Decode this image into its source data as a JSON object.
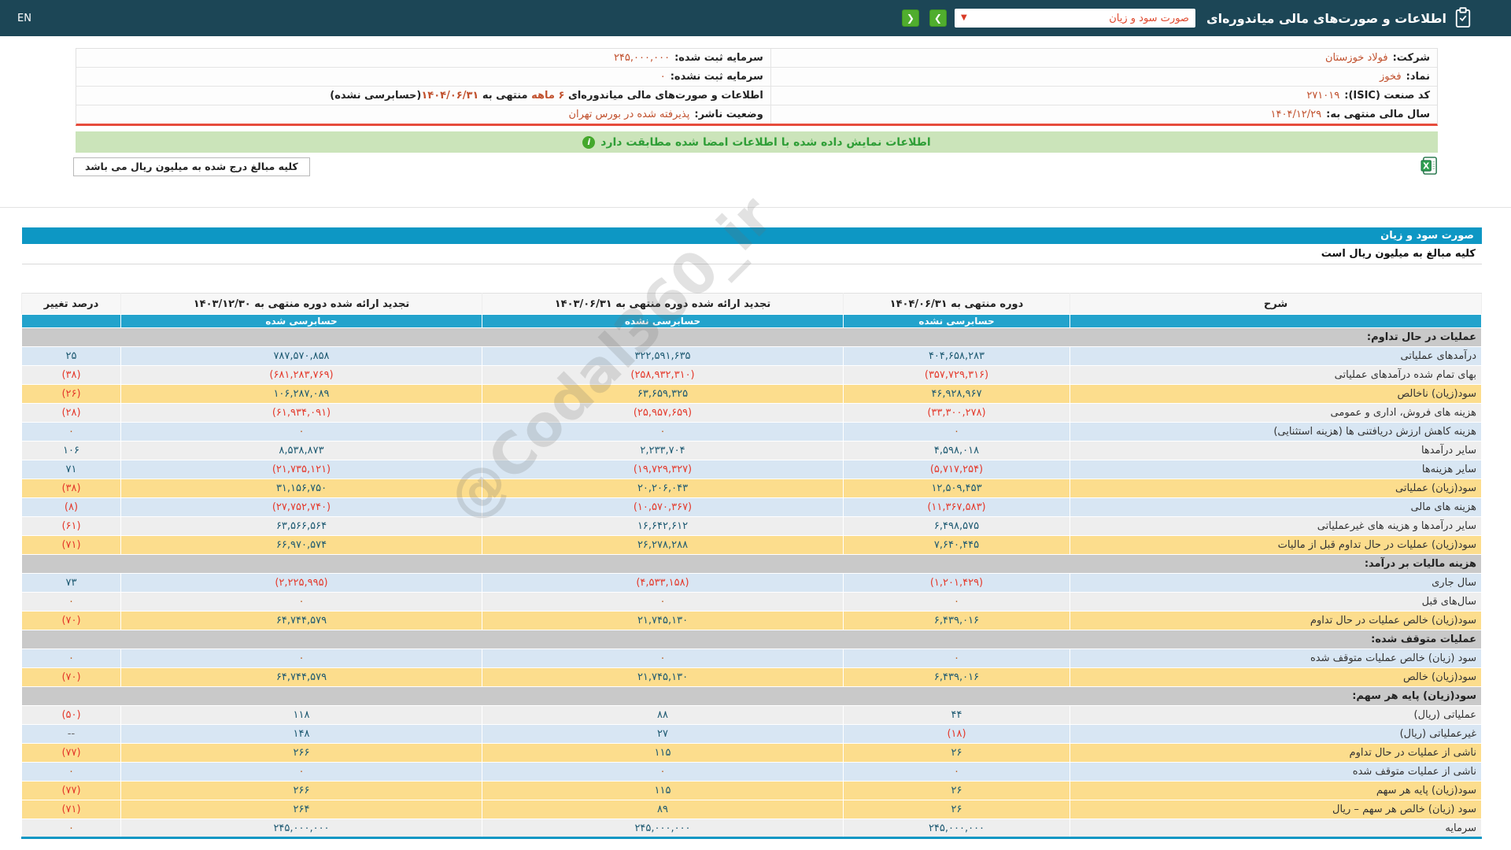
{
  "topbar": {
    "title": "اطلاعات و صورت‌های مالی میاندوره‌ای",
    "statement_select": {
      "value": "صورت سود و زیان"
    },
    "nav_forward": "❯",
    "nav_back": "❮",
    "language": "EN"
  },
  "company_info": {
    "right": [
      {
        "label": "شرکت:",
        "value": "فولاد خوزستان"
      },
      {
        "label": "نماد:",
        "value": "فخوز"
      },
      {
        "label": "کد صنعت (ISIC):",
        "value": "۲۷۱۰۱۹"
      },
      {
        "label": "سال مالی منتهی به:",
        "value": "۱۴۰۴/۱۲/۲۹"
      }
    ],
    "left": [
      {
        "label": "سرمایه ثبت شده:",
        "value": "۲۴۵,۰۰۰,۰۰۰"
      },
      {
        "label": "سرمایه ثبت نشده:",
        "value": "۰"
      },
      {
        "p1": "اطلاعات و صورت‌های مالی میاندوره‌ای",
        "p2": "۶ ماهه",
        "p3": "منتهی به",
        "p4": "۱۴۰۴/۰۶/۳۱",
        "p5": "(حسابرسی نشده)"
      },
      {
        "label": "وضعیت ناشر:",
        "value": "پذیرفته شده در بورس تهران"
      }
    ]
  },
  "banner": {
    "text": "اطلاعات نمایش داده شده با اطلاعات امضا شده مطابقت دارد"
  },
  "amounts_note": "کلیه مبالغ درج شده به میلیون ریال می باشد",
  "watermark": "@Codal360_ir",
  "statement": {
    "title": "صورت سود و زیان",
    "unit_note": "کلیه مبالغ به میلیون ریال است",
    "columns": {
      "description": "شرح",
      "period1": "دوره منتهی به ۱۴۰۴/۰۶/۳۱",
      "period1_sub": "حسابرسی نشده",
      "period2": "تجدید ارائه شده دوره منتهی به ۱۴۰۳/۰۶/۳۱",
      "period2_sub": "حسابرسی نشده",
      "period3": "تجدید ارائه شده دوره منتهی به ۱۴۰۳/۱۲/۳۰",
      "period3_sub": "حسابرسی شده",
      "change": "درصد تغییر"
    },
    "rows": [
      {
        "type": "section",
        "label": "عملیات در حال تداوم:"
      },
      {
        "type": "data",
        "bg": "blue",
        "label": "درآمدهای عملیاتی",
        "v1": "۴۰۴,۶۵۸,۲۸۳",
        "v2": "۳۲۲,۵۹۱,۶۳۵",
        "v3": "۷۸۷,۵۷۰,۸۵۸",
        "chg": "۲۵"
      },
      {
        "type": "data",
        "bg": "gray",
        "label": "بهای تمام شده درآمدهای عملیاتی",
        "v1": "(۳۵۷,۷۲۹,۳۱۶)",
        "v2": "(۲۵۸,۹۳۲,۳۱۰)",
        "v3": "(۶۸۱,۲۸۳,۷۶۹)",
        "chg": "(۳۸)"
      },
      {
        "type": "data",
        "bg": "yellow",
        "label": "سود(زیان) ناخالص",
        "v1": "۴۶,۹۲۸,۹۶۷",
        "v2": "۶۳,۶۵۹,۳۲۵",
        "v3": "۱۰۶,۲۸۷,۰۸۹",
        "chg": "(۲۶)"
      },
      {
        "type": "data",
        "bg": "gray",
        "label": "هزینه های فروش، اداری و عمومی",
        "v1": "(۳۳,۳۰۰,۲۷۸)",
        "v2": "(۲۵,۹۵۷,۶۵۹)",
        "v3": "(۶۱,۹۳۴,۰۹۱)",
        "chg": "(۲۸)"
      },
      {
        "type": "data",
        "bg": "blue",
        "label": "هزینه کاهش ارزش دریافتنی ها (هزینه استثنایی)",
        "v1": "۰",
        "v2": "۰",
        "v3": "۰",
        "chg": "۰"
      },
      {
        "type": "data",
        "bg": "gray",
        "label": "سایر درآمدها",
        "v1": "۴,۵۹۸,۰۱۸",
        "v2": "۲,۲۳۳,۷۰۴",
        "v3": "۸,۵۳۸,۸۷۳",
        "chg": "۱۰۶"
      },
      {
        "type": "data",
        "bg": "blue",
        "label": "سایر هزینه‌ها",
        "v1": "(۵,۷۱۷,۲۵۴)",
        "v2": "(۱۹,۷۲۹,۳۲۷)",
        "v3": "(۲۱,۷۳۵,۱۲۱)",
        "chg": "۷۱"
      },
      {
        "type": "data",
        "bg": "yellow",
        "label": "سود(زیان) عملیاتی",
        "v1": "۱۲,۵۰۹,۴۵۳",
        "v2": "۲۰,۲۰۶,۰۴۳",
        "v3": "۳۱,۱۵۶,۷۵۰",
        "chg": "(۳۸)"
      },
      {
        "type": "data",
        "bg": "blue",
        "label": "هزینه های مالی",
        "v1": "(۱۱,۳۶۷,۵۸۳)",
        "v2": "(۱۰,۵۷۰,۳۶۷)",
        "v3": "(۲۷,۷۵۲,۷۴۰)",
        "chg": "(۸)"
      },
      {
        "type": "data",
        "bg": "gray",
        "label": "سایر درآمدها و هزینه های غیرعملیاتی",
        "v1": "۶,۴۹۸,۵۷۵",
        "v2": "۱۶,۶۴۲,۶۱۲",
        "v3": "۶۳,۵۶۶,۵۶۴",
        "chg": "(۶۱)"
      },
      {
        "type": "data",
        "bg": "yellow",
        "label": "سود(زیان) عملیات در حال تداوم قبل از مالیات",
        "v1": "۷,۶۴۰,۴۴۵",
        "v2": "۲۶,۲۷۸,۲۸۸",
        "v3": "۶۶,۹۷۰,۵۷۴",
        "chg": "(۷۱)"
      },
      {
        "type": "section",
        "label": "هزینه مالیات بر درآمد:"
      },
      {
        "type": "data",
        "bg": "blue",
        "label": "سال جاری",
        "v1": "(۱,۲۰۱,۴۲۹)",
        "v2": "(۴,۵۳۳,۱۵۸)",
        "v3": "(۲,۲۲۵,۹۹۵)",
        "chg": "۷۳"
      },
      {
        "type": "data",
        "bg": "gray",
        "label": "سال‌های قبل",
        "v1": "۰",
        "v2": "۰",
        "v3": "۰",
        "chg": "۰"
      },
      {
        "type": "data",
        "bg": "yellow",
        "label": "سود(زیان) خالص عملیات در حال تداوم",
        "v1": "۶,۴۳۹,۰۱۶",
        "v2": "۲۱,۷۴۵,۱۳۰",
        "v3": "۶۴,۷۴۴,۵۷۹",
        "chg": "(۷۰)"
      },
      {
        "type": "section",
        "label": "عملیات متوقف شده:"
      },
      {
        "type": "data",
        "bg": "blue",
        "label": "سود (زیان) خالص عملیات متوقف شده",
        "v1": "۰",
        "v2": "۰",
        "v3": "۰",
        "chg": "۰"
      },
      {
        "type": "data",
        "bg": "yellow",
        "label": "سود(زیان) خالص",
        "v1": "۶,۴۳۹,۰۱۶",
        "v2": "۲۱,۷۴۵,۱۳۰",
        "v3": "۶۴,۷۴۴,۵۷۹",
        "chg": "(۷۰)"
      },
      {
        "type": "section",
        "label": "سود(زیان) پایه هر سهم:"
      },
      {
        "type": "data",
        "bg": "gray",
        "label": "عملیاتی (ریال)",
        "v1": "۴۴",
        "v2": "۸۸",
        "v3": "۱۱۸",
        "chg": "(۵۰)"
      },
      {
        "type": "data",
        "bg": "blue",
        "label": "غیرعملیاتی (ریال)",
        "v1": "(۱۸)",
        "v2": "۲۷",
        "v3": "۱۴۸",
        "chg": "--"
      },
      {
        "type": "data",
        "bg": "yellow",
        "label": "ناشی از عملیات در حال تداوم",
        "v1": "۲۶",
        "v2": "۱۱۵",
        "v3": "۲۶۶",
        "chg": "(۷۷)"
      },
      {
        "type": "data",
        "bg": "blue",
        "label": "ناشی از عملیات متوقف شده",
        "v1": "۰",
        "v2": "۰",
        "v3": "۰",
        "chg": "۰"
      },
      {
        "type": "data",
        "bg": "yellow",
        "label": "سود(زیان) پایه هر سهم",
        "v1": "۲۶",
        "v2": "۱۱۵",
        "v3": "۲۶۶",
        "chg": "(۷۷)"
      },
      {
        "type": "data",
        "bg": "yellow",
        "label": "سود (زیان) خالص هر سهم – ریال",
        "v1": "۲۶",
        "v2": "۸۹",
        "v3": "۲۶۴",
        "chg": "(۷۱)"
      },
      {
        "type": "data",
        "bg": "gray",
        "label": "سرمایه",
        "v1": "۲۴۵,۰۰۰,۰۰۰",
        "v2": "۲۴۵,۰۰۰,۰۰۰",
        "v3": "۲۴۵,۰۰۰,۰۰۰",
        "chg": "۰"
      }
    ]
  }
}
